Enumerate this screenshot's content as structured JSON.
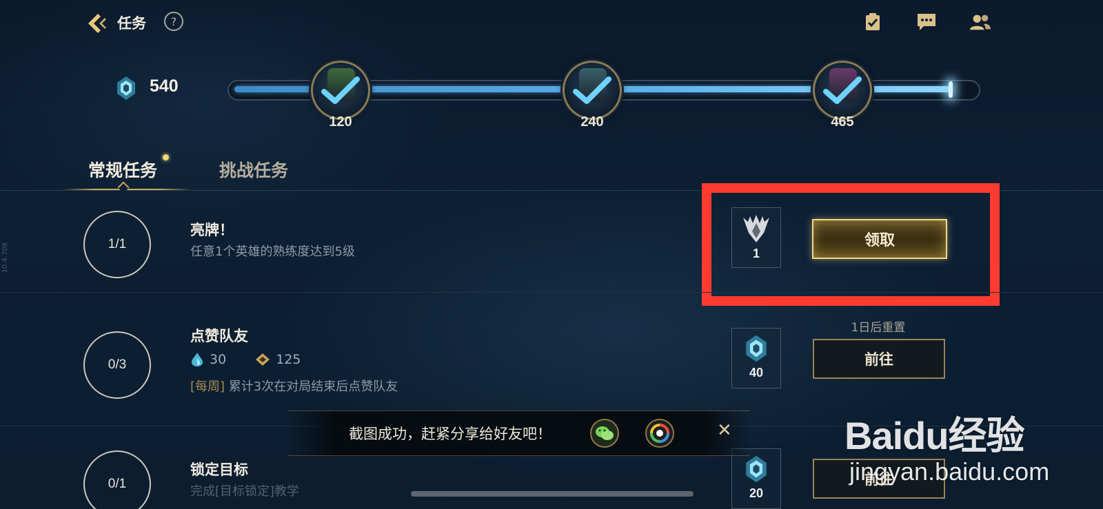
{
  "header": {
    "back_icon": "back-arrow-icon",
    "title": "任务",
    "help_label": "?",
    "icons": [
      "checklist-icon",
      "chat-icon",
      "friends-icon"
    ]
  },
  "progress": {
    "points": "540",
    "fill_fraction": 0.97,
    "milestones": [
      {
        "value": "120",
        "state": "completed",
        "chest_color": "#3d6a3c"
      },
      {
        "value": "240",
        "state": "completed",
        "chest_color": "#3a5f6a"
      },
      {
        "value": "465",
        "state": "completed",
        "chest_color": "#6a3a6a"
      }
    ]
  },
  "tabs": [
    {
      "label": "常规任务",
      "active": true,
      "has_dot": true
    },
    {
      "label": "挑战任务",
      "active": false
    }
  ],
  "tasks": [
    {
      "progress": "1/1",
      "title": "亮牌！",
      "desc": "任意1个英雄的熟练度达到5级",
      "reward_icon": "mastery-emblem-icon",
      "reward_amount": "1",
      "button": "领取"
    },
    {
      "progress": "0/3",
      "title": "点赞队友",
      "small_rewards": [
        {
          "icon": "blue-essence-icon",
          "value": "30"
        },
        {
          "icon": "gold-token-icon",
          "value": "125"
        }
      ],
      "tag": "[每周]",
      "desc": "累计3次在对局结束后点赞队友",
      "reset_text": "1日后重置",
      "reward_icon": "pass-points-icon",
      "reward_amount": "40",
      "button": "前往"
    },
    {
      "progress": "0/1",
      "title": "锁定目标",
      "desc": "完成[目标锁定]教学",
      "reward_icon": "pass-points-icon",
      "reward_amount": "20",
      "button": "前往"
    }
  ],
  "toast": {
    "text": "截图成功，赶紧分享给好友吧！",
    "share_icons": [
      "wechat-icon",
      "moments-icon"
    ],
    "close_label": "✕"
  },
  "watermark": {
    "text": "Baidu经验",
    "url": "jingyan.baidu.com"
  },
  "version": "10.4.708",
  "colors": {
    "highlight": "#ff3b30",
    "gold": "#f0d98c",
    "progress_blue": "#5fb3ec"
  }
}
